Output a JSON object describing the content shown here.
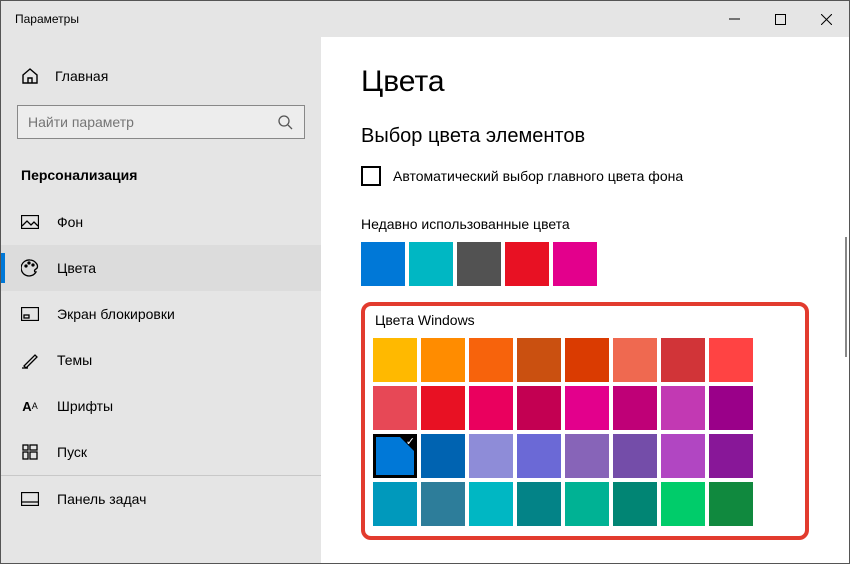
{
  "window": {
    "title": "Параметры"
  },
  "sidebar": {
    "home": "Главная",
    "search_placeholder": "Найти параметр",
    "section": "Персонализация",
    "items": [
      {
        "label": "Фон"
      },
      {
        "label": "Цвета"
      },
      {
        "label": "Экран блокировки"
      },
      {
        "label": "Темы"
      },
      {
        "label": "Шрифты"
      },
      {
        "label": "Пуск"
      },
      {
        "label": "Панель задач"
      }
    ]
  },
  "main": {
    "title": "Цвета",
    "section_heading": "Выбор цвета элементов",
    "auto_checkbox_label": "Автоматический выбор главного цвета фона",
    "recent_label": "Недавно использованные цвета",
    "recent_colors": [
      "#0078d7",
      "#00b7c3",
      "#525252",
      "#e81123",
      "#e3008c"
    ],
    "windows_label": "Цвета Windows",
    "windows_colors": [
      [
        "#ffb900",
        "#ff8c00",
        "#f7630c",
        "#ca5010",
        "#da3b01",
        "#ef6950",
        "#d13438",
        "#ff4343"
      ],
      [
        "#e74856",
        "#e81123",
        "#ea005e",
        "#c30052",
        "#e3008c",
        "#bf0077",
        "#c239b3",
        "#9a0089"
      ],
      [
        "#0078d7",
        "#0063b1",
        "#8e8cd8",
        "#6b69d6",
        "#8764b8",
        "#744da9",
        "#b146c2",
        "#881798"
      ],
      [
        "#0099bc",
        "#2d7d9a",
        "#00b7c3",
        "#038387",
        "#00b294",
        "#018574",
        "#00cc6a",
        "#10893e"
      ]
    ],
    "selected": {
      "row": 2,
      "col": 0
    }
  }
}
